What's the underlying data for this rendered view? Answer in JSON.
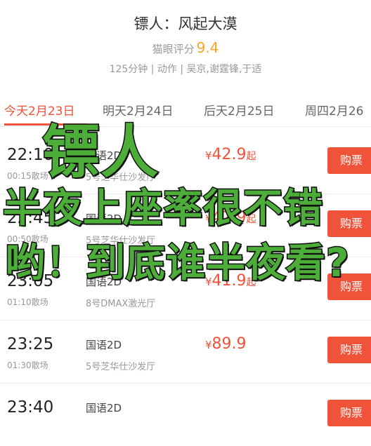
{
  "movie": {
    "title": "镖人：风起大漠",
    "rating_label": "猫眼评分",
    "rating_score": "9.4",
    "meta": "125分钟 | 动作 | 吴京,谢霆锋,于适"
  },
  "tabs": [
    "今天2月23日",
    "明天2月24日",
    "后天2月25日",
    "周四2月26"
  ],
  "showtimes": [
    {
      "time": "22:10",
      "end": "00:15散场",
      "lang": "国语2D",
      "hall": "5号芝华仕沙发厅",
      "price": "42.9",
      "suffix": "起",
      "button": "购票"
    },
    {
      "time": "22:45",
      "end": "00:50散场",
      "lang": "国语2D",
      "hall": "5号芝华仕沙发厅",
      "price": "42.9",
      "suffix": "起",
      "button": "购票"
    },
    {
      "time": "23:05",
      "end": "01:10散场",
      "lang": "国语2D",
      "hall": "8号DMAX激光厅",
      "price": "41.9",
      "suffix": "起",
      "button": "购票"
    },
    {
      "time": "23:25",
      "end": "01:30散场",
      "lang": "国语2D",
      "hall": "5号芝华仕沙发厅",
      "price": "89.9",
      "suffix": "",
      "button": "购票"
    },
    {
      "time": "23:40",
      "end": "",
      "lang": "国语2D",
      "hall": "",
      "price": "",
      "suffix": "",
      "button": "购票"
    }
  ],
  "currency_symbol": "¥",
  "captions": [
    "镖人",
    "半夜上座率很不错",
    "哟！到底谁半夜看?"
  ],
  "colors": {
    "accent": "#f0523a",
    "rating": "#f5a623",
    "caption": "#4cad39"
  }
}
